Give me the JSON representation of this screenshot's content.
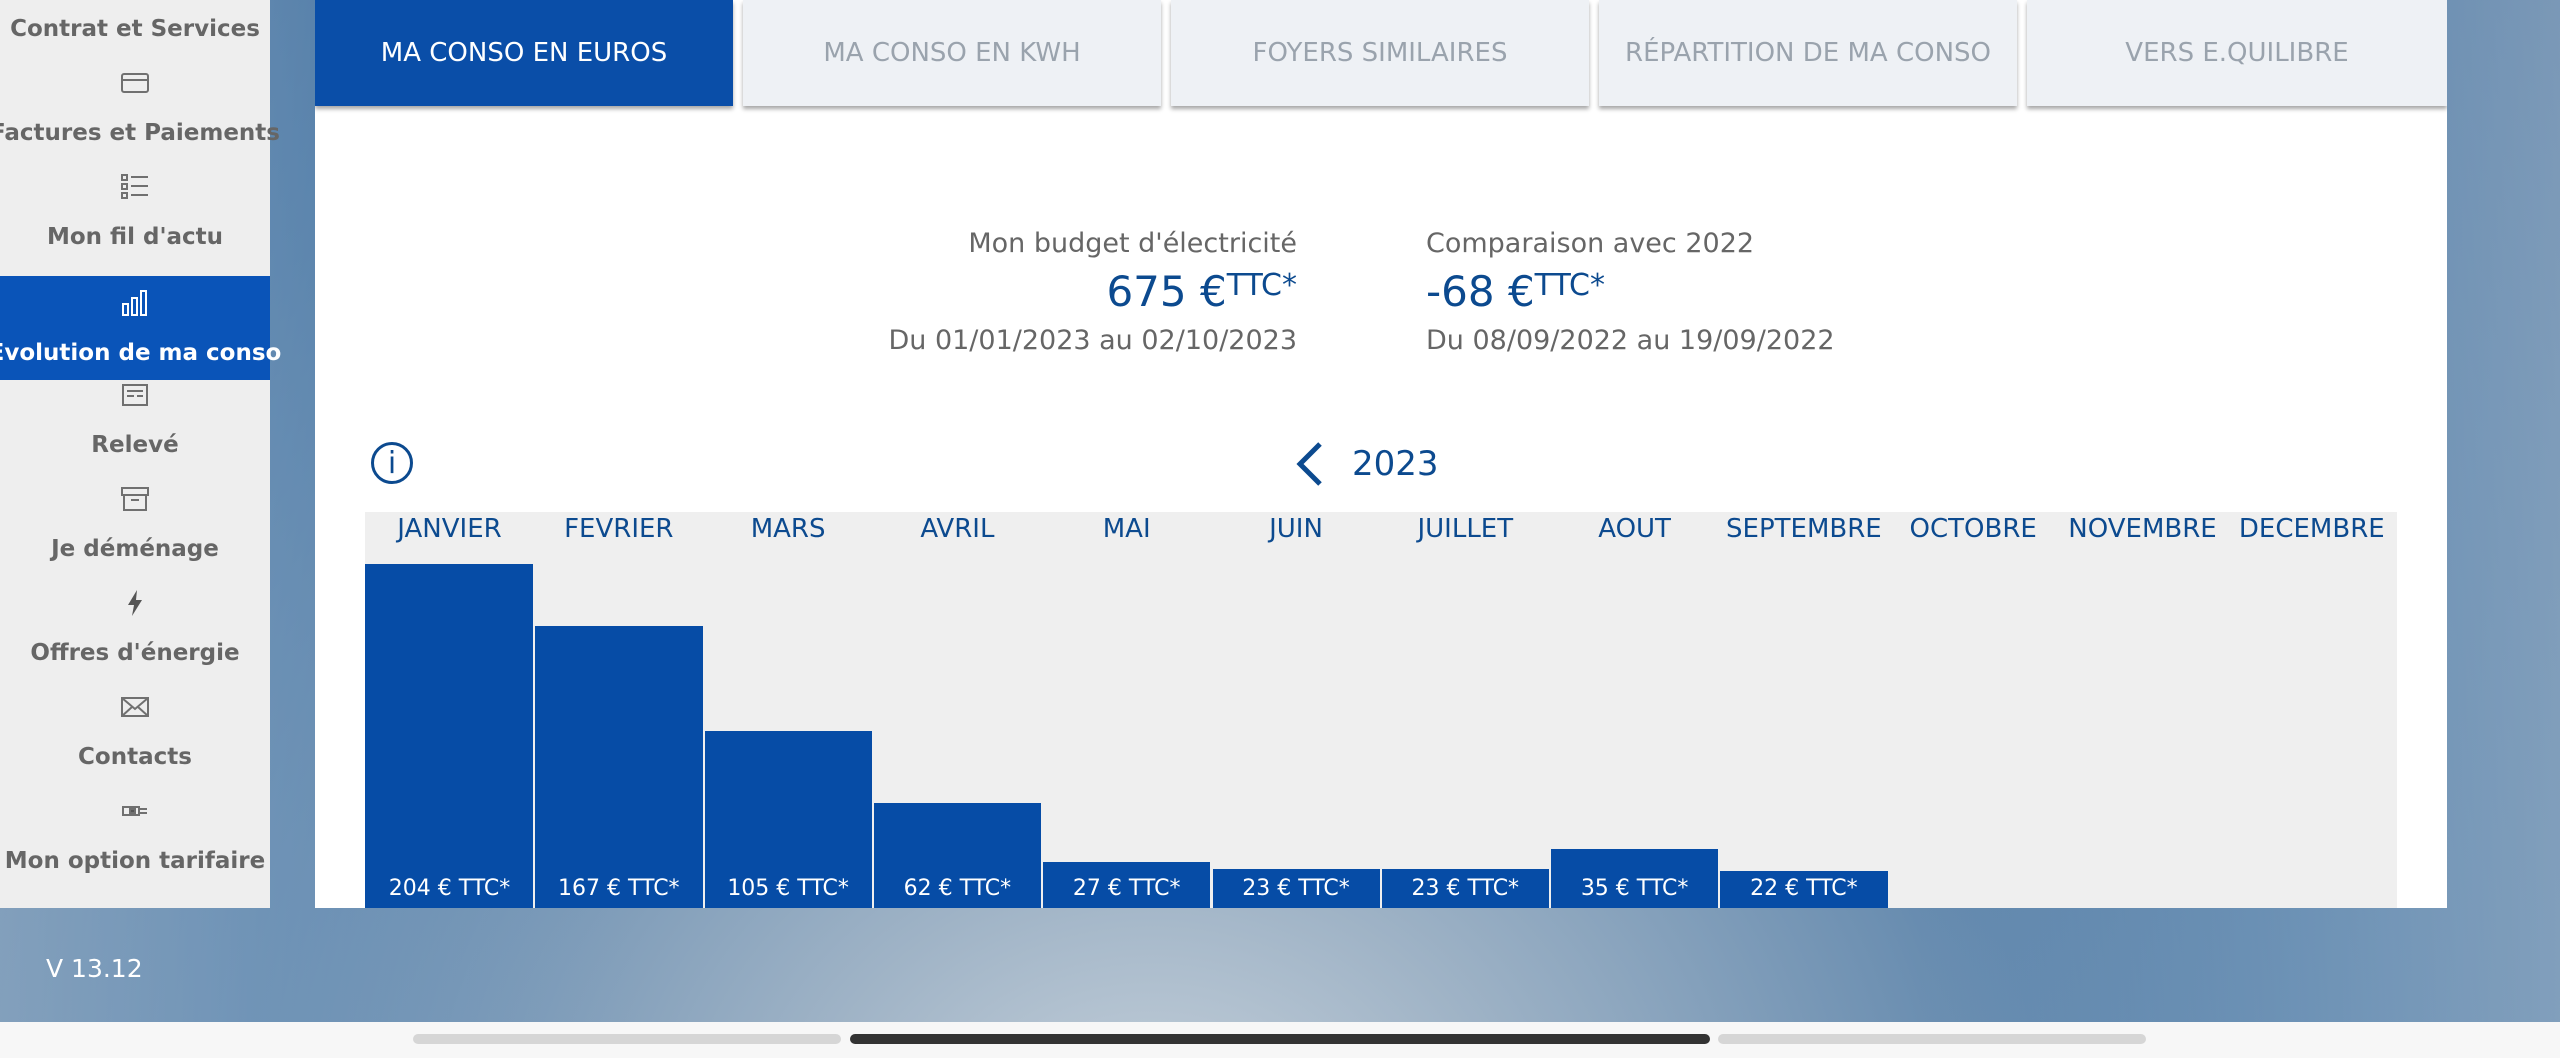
{
  "sidebar": {
    "items": [
      {
        "label": "Contrat et Services",
        "icon": "contract-icon"
      },
      {
        "label": "Factures et Paiements",
        "icon": "card-icon"
      },
      {
        "label": "Mon fil d'actu",
        "icon": "list-icon"
      },
      {
        "label": "Evolution de ma conso",
        "icon": "bar-chart-icon",
        "active": true
      },
      {
        "label": "Relevé",
        "icon": "meter-icon"
      },
      {
        "label": "Je déménage",
        "icon": "box-icon"
      },
      {
        "label": "Offres d'énergie",
        "icon": "lightning-icon"
      },
      {
        "label": "Contacts",
        "icon": "envelope-icon"
      },
      {
        "label": "Mon option tarifaire",
        "icon": "plug-icon"
      }
    ]
  },
  "version": "V 13.12",
  "tabs": [
    {
      "label": "MA CONSO EN EUROS",
      "active": true
    },
    {
      "label": "MA CONSO EN KWH"
    },
    {
      "label": "FOYERS SIMILAIRES"
    },
    {
      "label": "RÉPARTITION DE MA CONSO"
    },
    {
      "label": "VERS E.QUILIBRE"
    }
  ],
  "summary": {
    "budget": {
      "title": "Mon budget d'électricité",
      "value": "675 €",
      "suffix": "TTC*",
      "period": "Du 01/01/2023 au 02/10/2023"
    },
    "comparison": {
      "title": "Comparaison avec 2022",
      "value": "-68 €",
      "suffix": "TTC*",
      "period": "Du 08/09/2022 au 19/09/2022"
    }
  },
  "year": "2023",
  "colors": {
    "primary": "#0a54b8",
    "bar": "#064ca6",
    "text_blue": "#0c4a8f"
  },
  "chart_data": {
    "type": "bar",
    "categories": [
      "JANVIER",
      "FEVRIER",
      "MARS",
      "AVRIL",
      "MAI",
      "JUIN",
      "JUILLET",
      "AOUT",
      "SEPTEMBRE",
      "OCTOBRE",
      "NOVEMBRE",
      "DECEMBRE"
    ],
    "values": [
      204,
      167,
      105,
      62,
      27,
      23,
      23,
      35,
      22,
      null,
      null,
      null
    ],
    "labels": [
      "204 € TTC*",
      "167 € TTC*",
      "105 € TTC*",
      "62 € TTC*",
      "27 € TTC*",
      "23 € TTC*",
      "23 € TTC*",
      "35 € TTC*",
      "22 € TTC*",
      "",
      "",
      ""
    ],
    "ylim": [
      0,
      230
    ],
    "grid": false
  }
}
